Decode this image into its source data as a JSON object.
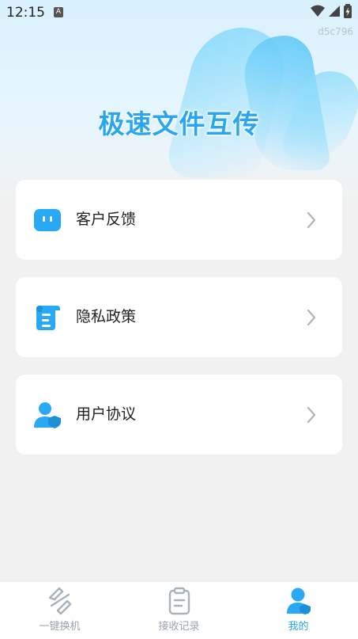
{
  "status_bar": {
    "time": "12:15",
    "a_badge": "A"
  },
  "watermark": "d5c796",
  "hero": {
    "title": "极速文件互传"
  },
  "menu": [
    {
      "label": "客户反馈",
      "icon": "chat-bubble-icon"
    },
    {
      "label": "隐私政策",
      "icon": "scroll-document-icon"
    },
    {
      "label": "用户协议",
      "icon": "user-shield-icon"
    }
  ],
  "tabs": [
    {
      "label": "一键换机",
      "icon": "swap-phone-icon",
      "active": false
    },
    {
      "label": "接收记录",
      "icon": "clipboard-icon",
      "active": false
    },
    {
      "label": "我的",
      "icon": "profile-icon",
      "active": true
    }
  ],
  "colors": {
    "accent": "#2aa6f0",
    "inactive": "#9aa3ad",
    "background": "#f1f1f1"
  }
}
